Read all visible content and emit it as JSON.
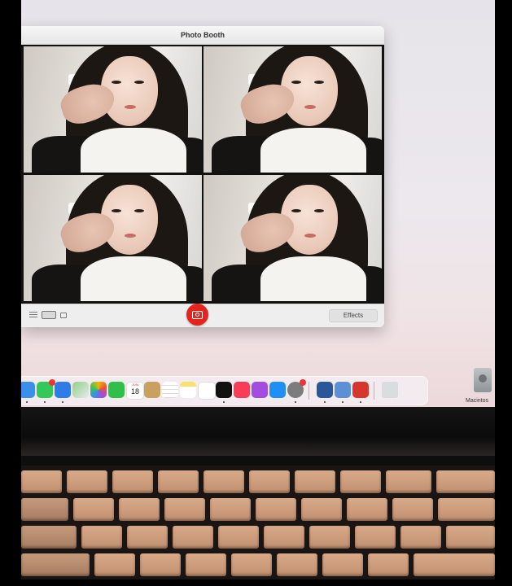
{
  "window": {
    "title": "Photo Booth"
  },
  "toolbar": {
    "effects_label": "Effects",
    "view_modes": [
      "grid-view",
      "single-view",
      "video-view"
    ]
  },
  "photos": {
    "count": 4,
    "layout": "2x2"
  },
  "desktop": {
    "disk_label": "Macintos"
  },
  "dock": {
    "items": [
      {
        "name": "finder",
        "color": "#3b8fe8"
      },
      {
        "name": "messages",
        "color": "#34c759",
        "badge": true
      },
      {
        "name": "mail",
        "color": "#2f7ce8"
      },
      {
        "name": "maps",
        "color": "#5cb85c"
      },
      {
        "name": "photos",
        "color": "#f4b400"
      },
      {
        "name": "facetime",
        "color": "#2fbf4a"
      },
      {
        "name": "calendar",
        "color": "#ffffff",
        "month": "JUN",
        "day": "18"
      },
      {
        "name": "contacts",
        "color": "#c8a060"
      },
      {
        "name": "reminders",
        "color": "#ffffff"
      },
      {
        "name": "notes",
        "color": "#f7e36b"
      },
      {
        "name": "freeform",
        "color": "#ffffff"
      },
      {
        "name": "apple-tv",
        "color": "#111111",
        "text": "tv"
      },
      {
        "name": "music",
        "color": "#fa3d56"
      },
      {
        "name": "podcasts",
        "color": "#a24ce0"
      },
      {
        "name": "app-store",
        "color": "#1f8ef5"
      },
      {
        "name": "system-settings",
        "color": "#7c7c7c",
        "badge": true
      },
      {
        "name": "word",
        "color": "#2b579a"
      },
      {
        "name": "preview",
        "color": "#5b8fd6"
      },
      {
        "name": "photo-booth",
        "color": "#d8362c"
      },
      {
        "name": "trash",
        "color": "#d9dde0"
      }
    ]
  }
}
